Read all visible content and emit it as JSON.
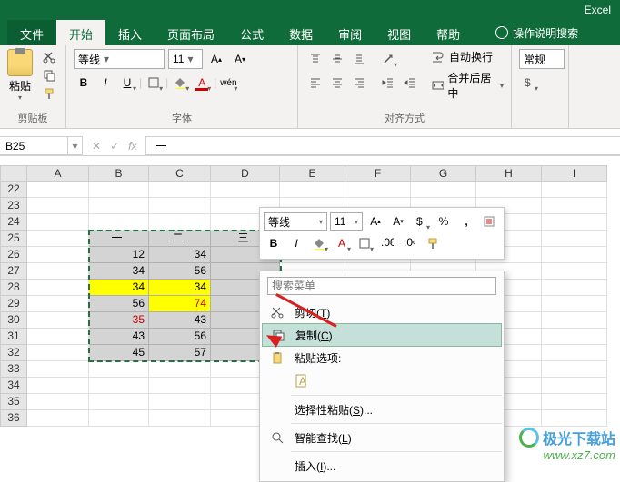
{
  "titlebar": {
    "app": "Excel"
  },
  "tabs": {
    "file": "文件",
    "home": "开始",
    "insert": "插入",
    "page_layout": "页面布局",
    "formulas": "公式",
    "data": "数据",
    "review": "审阅",
    "view": "视图",
    "help": "帮助",
    "tell_me": "操作说明搜索"
  },
  "ribbon": {
    "clipboard": {
      "label": "剪贴板",
      "paste": "粘贴"
    },
    "font": {
      "label": "字体",
      "name": "等线",
      "size": "11",
      "bold": "B",
      "italic": "I",
      "underline": "U",
      "phonetic": "wén"
    },
    "alignment": {
      "label": "对齐方式",
      "wrap": "自动换行",
      "merge": "合并后居中"
    },
    "number": {
      "label": "",
      "format": "常规"
    }
  },
  "namebox": {
    "ref": "B25",
    "formula": "一"
  },
  "sheet": {
    "cols": [
      "A",
      "B",
      "C",
      "D",
      "E",
      "F",
      "G",
      "H",
      "I"
    ],
    "rows": [
      "22",
      "23",
      "24",
      "25",
      "26",
      "27",
      "28",
      "29",
      "30",
      "31",
      "32",
      "33",
      "34",
      "35",
      "36"
    ],
    "headers": [
      "一",
      "二",
      "三"
    ],
    "data": [
      [
        "12",
        "34",
        ""
      ],
      [
        "34",
        "56",
        ""
      ],
      [
        "34",
        "34",
        ""
      ],
      [
        "56",
        "74",
        ""
      ],
      [
        "35",
        "43",
        ""
      ],
      [
        "43",
        "56",
        ""
      ],
      [
        "45",
        "57",
        ""
      ]
    ]
  },
  "mini": {
    "font": "等线",
    "size": "11",
    "bold": "B",
    "italic": "I"
  },
  "menu": {
    "search_placeholder": "搜索菜单",
    "cut": "剪切(T)",
    "copy": "复制(C)",
    "paste_options": "粘贴选项:",
    "paste_special": "选择性粘贴(S)...",
    "smart_lookup": "智能查找(L)",
    "insert": "插入(I)..."
  },
  "watermark": {
    "text": "极光下载站",
    "url": "www.xz7.com"
  },
  "chart_data": {
    "type": "table",
    "title": "",
    "columns": [
      "一",
      "二",
      "三"
    ],
    "rows": [
      [
        12,
        34,
        null
      ],
      [
        34,
        56,
        null
      ],
      [
        34,
        34,
        null
      ],
      [
        56,
        74,
        null
      ],
      [
        35,
        43,
        null
      ],
      [
        43,
        56,
        null
      ],
      [
        45,
        57,
        null
      ]
    ],
    "highlights": {
      "yellow_cells": [
        [
          2,
          0
        ],
        [
          2,
          1
        ],
        [
          3,
          1
        ]
      ],
      "red_text_cells": [
        [
          3,
          1
        ],
        [
          4,
          0
        ]
      ]
    }
  }
}
